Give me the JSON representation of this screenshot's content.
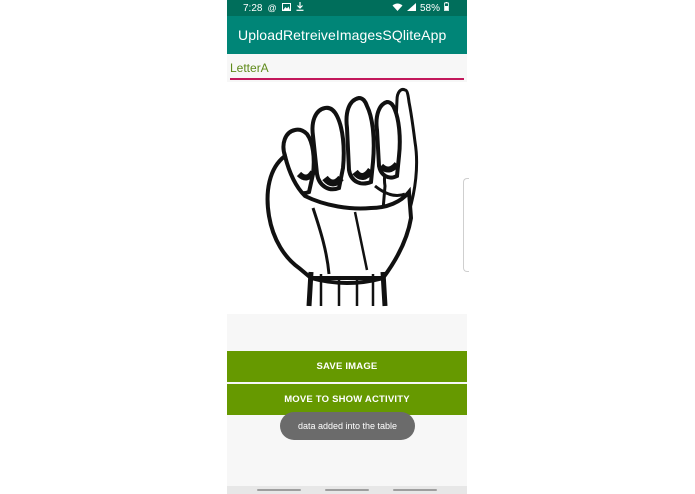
{
  "status_bar": {
    "time": "7:28",
    "battery": "58%",
    "icons": [
      "at-sign-icon",
      "image-icon",
      "download-icon",
      "wifi-icon",
      "signal-icon",
      "battery-icon"
    ]
  },
  "app_bar": {
    "title": "UploadRetreiveImagesSQliteApp"
  },
  "form": {
    "name_value": "LetterA"
  },
  "image": {
    "subject": "hand-sign-letter-a-icon"
  },
  "buttons": {
    "save_label": "SAVE IMAGE",
    "move_label": "MOVE TO SHOW ACTIVITY"
  },
  "toast": {
    "message": "data added into the table"
  },
  "colors": {
    "status_bar": "#006e5b",
    "app_bar": "#008577",
    "button": "#669900",
    "input_text": "#5f8a1a",
    "input_underline": "#c2185b",
    "toast": "#6b6b6b"
  }
}
